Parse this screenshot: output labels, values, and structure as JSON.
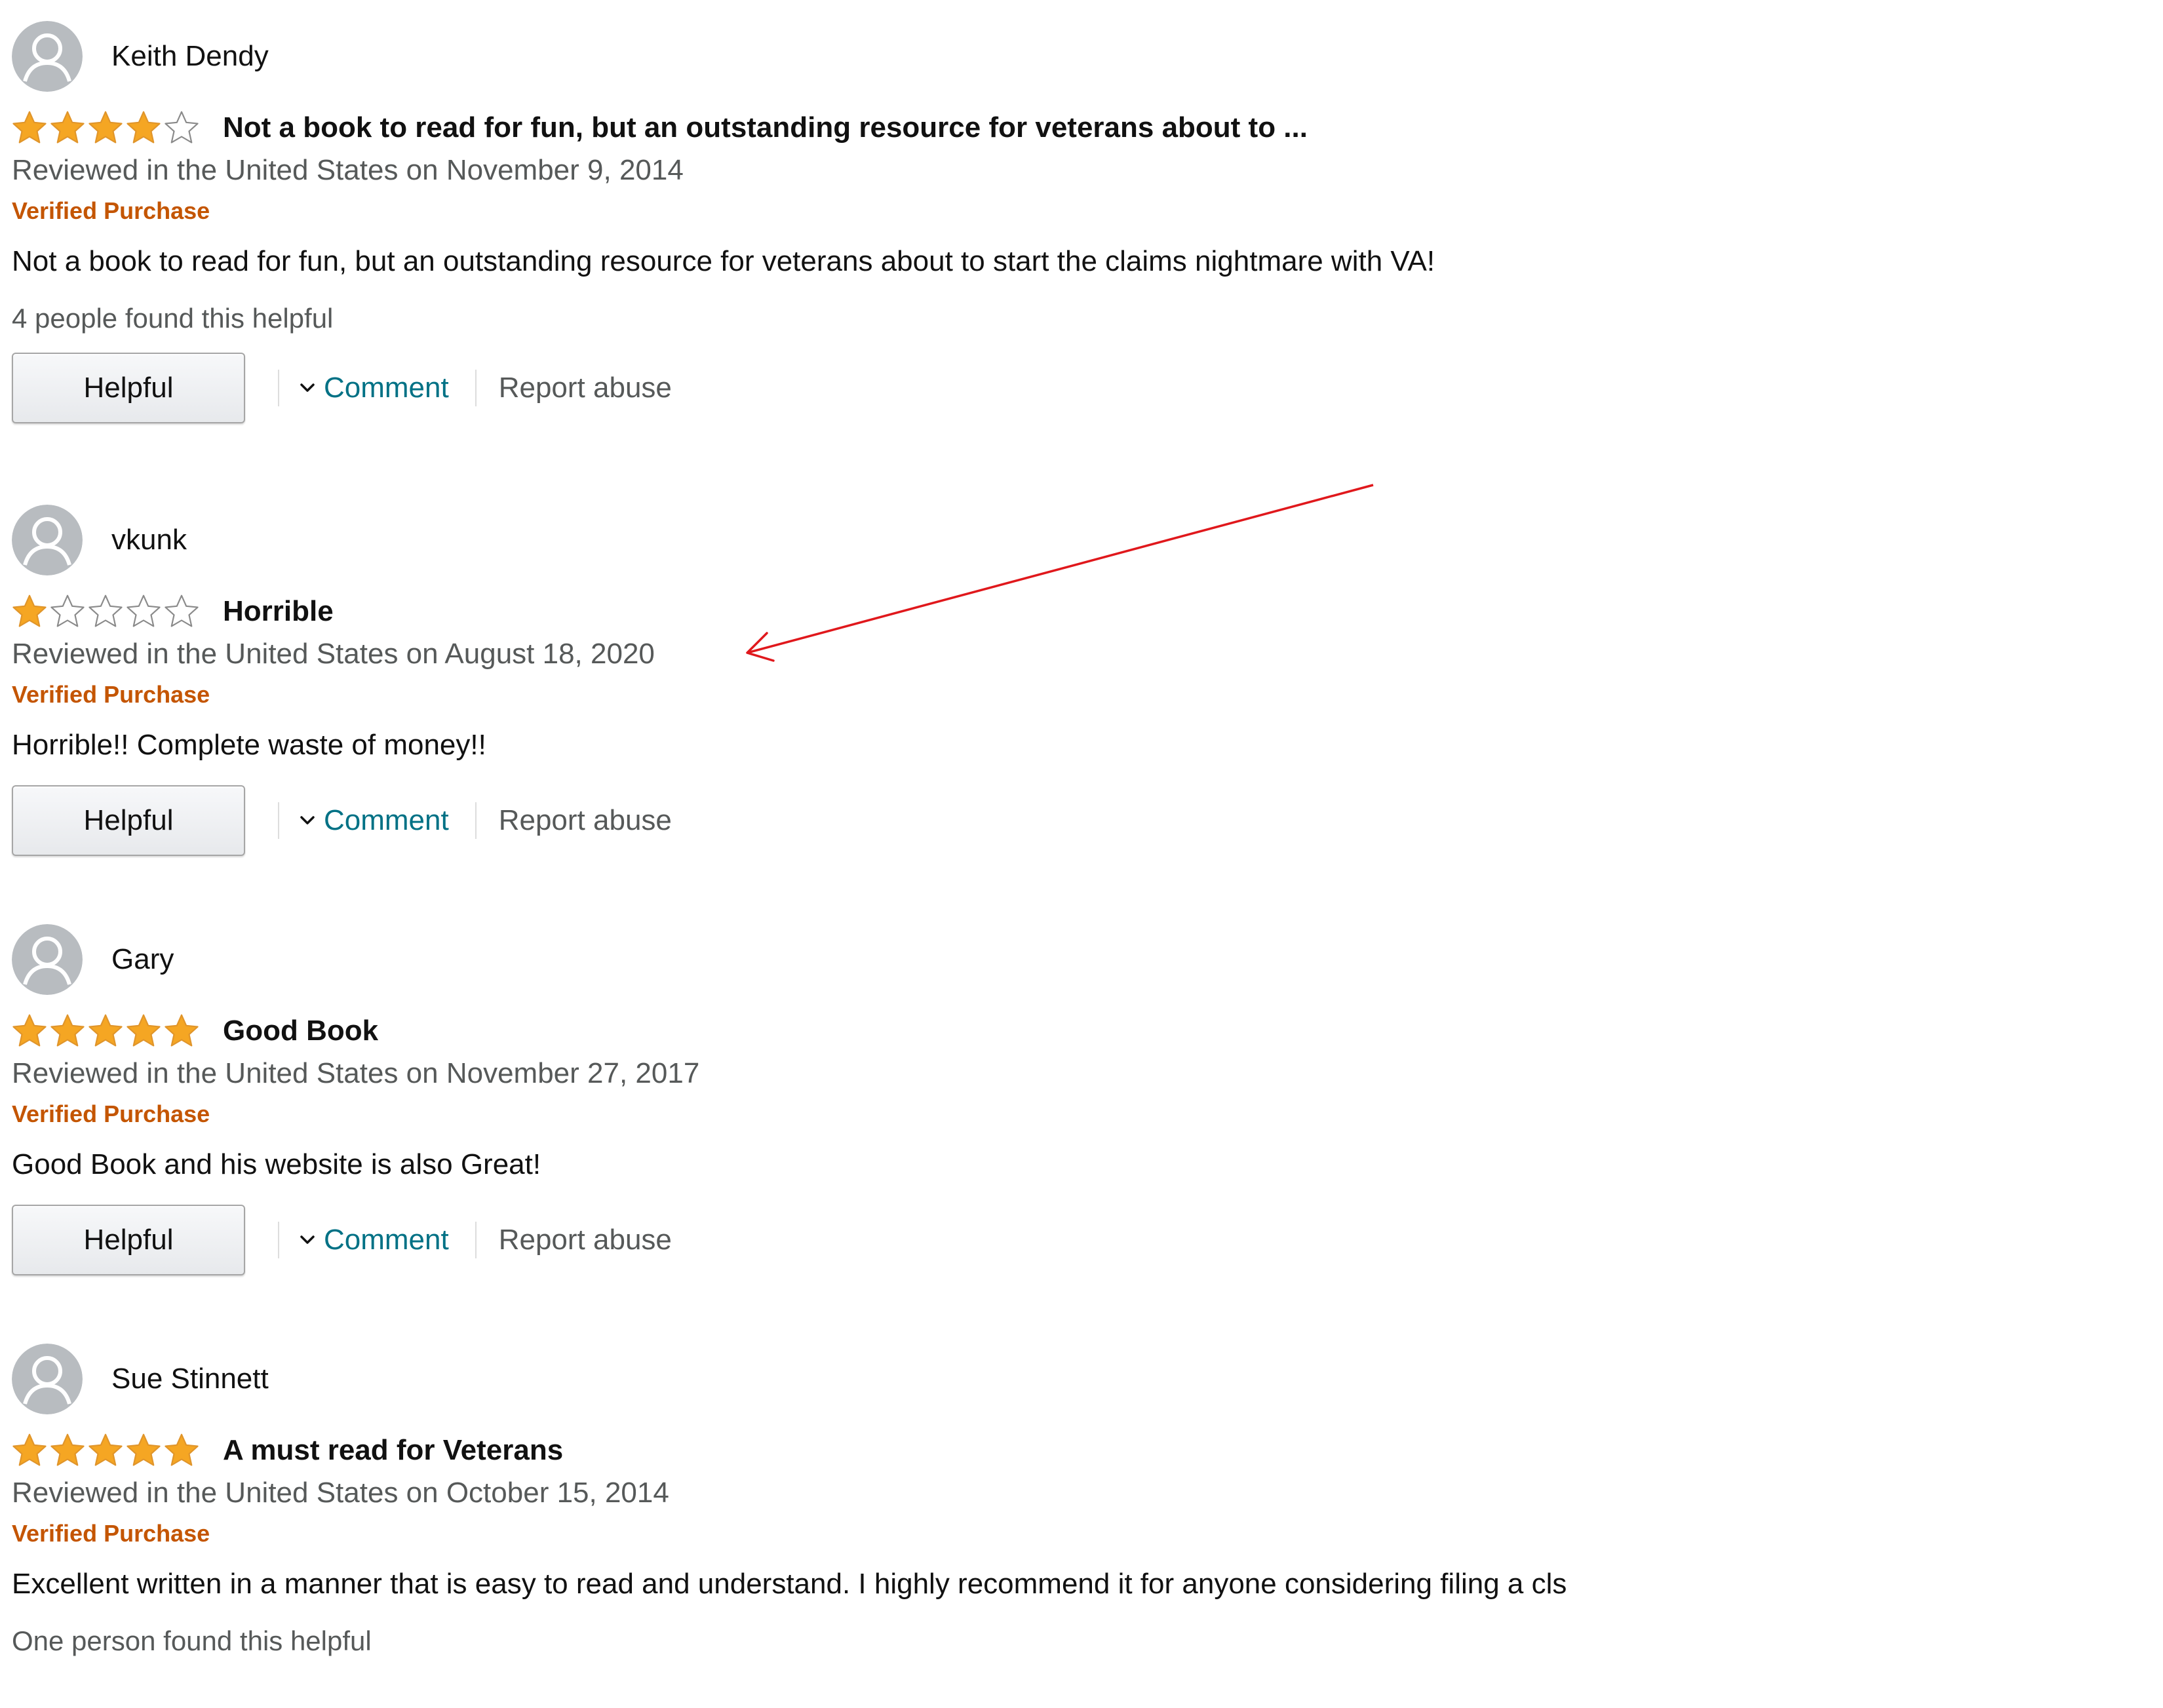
{
  "colors": {
    "star_fill": "#f5a623",
    "star_outline": "#e0952b",
    "verified": "#c45500",
    "link": "#007185",
    "muted": "#565959",
    "annotation": "#e0181c"
  },
  "icons": {
    "avatar": "default-user-avatar-icon",
    "star_full": "star-filled-icon",
    "star_empty": "star-empty-icon",
    "chevron": "chevron-down-icon"
  },
  "reviews": [
    {
      "name": "Keith Dendy",
      "rating": 4,
      "title": "Not a book to read for fun, but an outstanding resource for veterans about to ...",
      "date": "Reviewed in the United States on November 9, 2014",
      "verified": "Verified Purchase",
      "body": "Not a book to read for fun, but an outstanding resource for veterans about to start the claims nightmare with VA!",
      "helpful_count": "4 people found this helpful",
      "helpful_label": "Helpful",
      "comment_label": "Comment",
      "report_label": "Report abuse"
    },
    {
      "name": "vkunk",
      "rating": 1,
      "title": "Horrible",
      "date": "Reviewed in the United States on August 18, 2020",
      "verified": "Verified Purchase",
      "body": "Horrible!! Complete waste of money!!",
      "helpful_count": "",
      "helpful_label": "Helpful",
      "comment_label": "Comment",
      "report_label": "Report abuse"
    },
    {
      "name": "Gary",
      "rating": 5,
      "title": "Good Book",
      "date": "Reviewed in the United States on November 27, 2017",
      "verified": "Verified Purchase",
      "body": "Good Book and his website is also Great!",
      "helpful_count": "",
      "helpful_label": "Helpful",
      "comment_label": "Comment",
      "report_label": "Report abuse"
    },
    {
      "name": "Sue Stinnett",
      "rating": 5,
      "title": "A must read for Veterans",
      "date": "Reviewed in the United States on October 15, 2014",
      "verified": "Verified Purchase",
      "body": "Excellent written in a manner that is easy to read and understand. I highly recommend it for anyone considering filing a cls",
      "helpful_count": "One person found this helpful",
      "helpful_label": "",
      "comment_label": "",
      "report_label": ""
    }
  ]
}
